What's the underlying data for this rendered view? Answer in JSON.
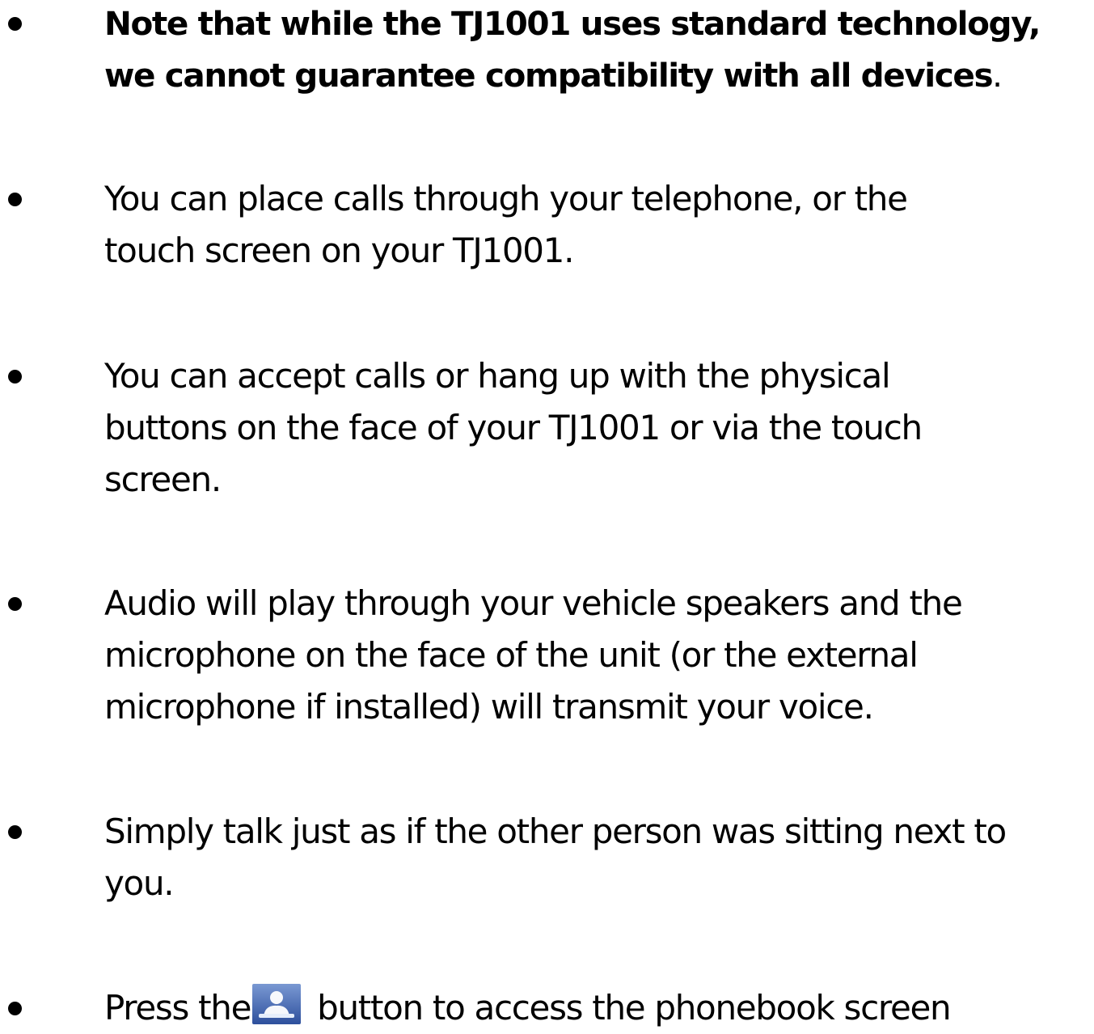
{
  "bullets": [
    {
      "lines": [
        "Note that while the TJ1001 uses standard technology,",
        "we cannot guarantee compatibility with all devices"
      ],
      "trailing": ".",
      "bold": true
    },
    {
      "lines": [
        "You can place calls through your telephone, or the",
        "touch screen on your TJ1001."
      ]
    },
    {
      "lines": [
        "You can accept calls or hang up with the physical",
        "buttons on the face of your TJ1001 or via the touch",
        "screen."
      ]
    },
    {
      "lines": [
        "Audio will play through your vehicle speakers and the",
        "microphone on the face of the unit (or the external",
        "microphone if installed) will transmit your voice."
      ]
    },
    {
      "lines": [
        "Simply talk just as if the other person was sitting next to",
        "you."
      ]
    },
    {
      "before_icon": "Press the",
      "icon": "phonebook-icon",
      "after_icon": "button to access the phonebook screen"
    }
  ]
}
